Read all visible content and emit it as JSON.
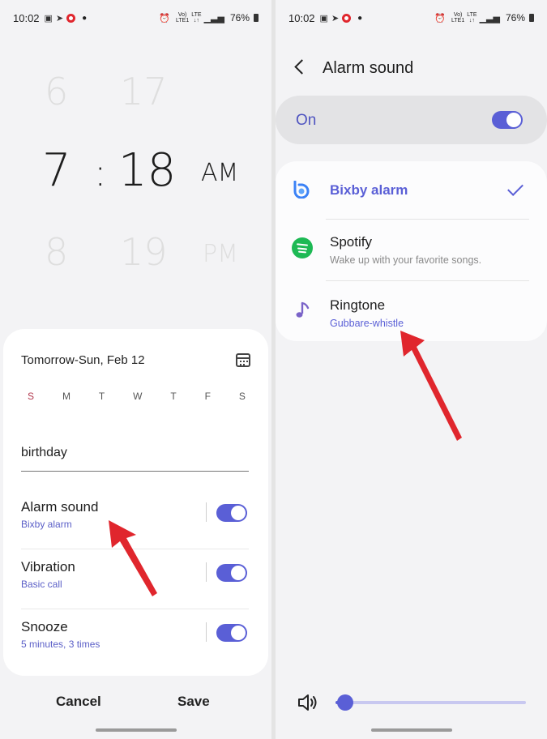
{
  "left_screen": {
    "status_bar": {
      "time": "10:02",
      "battery": "76%"
    },
    "time_picker": {
      "hours": {
        "prev": "6",
        "current": "7",
        "next": "8"
      },
      "separator": ":",
      "minutes": {
        "prev": "17",
        "current": "18",
        "next": "19"
      },
      "period": {
        "current": "AM",
        "next": "PM"
      }
    },
    "alarm": {
      "date": "Tomorrow-Sun, Feb 12",
      "days": [
        "S",
        "M",
        "T",
        "W",
        "T",
        "F",
        "S"
      ],
      "name": "birthday",
      "settings": [
        {
          "title": "Alarm sound",
          "subtitle": "Bixby alarm",
          "enabled": true
        },
        {
          "title": "Vibration",
          "subtitle": "Basic call",
          "enabled": true
        },
        {
          "title": "Snooze",
          "subtitle": "5 minutes, 3 times",
          "enabled": true
        }
      ]
    },
    "buttons": {
      "cancel": "Cancel",
      "save": "Save"
    }
  },
  "right_screen": {
    "status_bar": {
      "time": "10:02",
      "battery": "76%"
    },
    "header": {
      "title": "Alarm sound"
    },
    "master_toggle": {
      "label": "On",
      "enabled": true
    },
    "sound_options": [
      {
        "title": "Bixby alarm",
        "selected": true,
        "icon": "bixby-icon"
      },
      {
        "title": "Spotify",
        "subtitle": "Wake up with your favorite songs.",
        "icon": "spotify-icon"
      },
      {
        "title": "Ringtone",
        "subtitle": "Gubbare-whistle",
        "icon": "music-note-icon"
      }
    ],
    "volume": {
      "level": 0.05
    }
  },
  "colors": {
    "accent": "#5a5fd6",
    "sunday": "#b2384e",
    "arrow": "#e0262d",
    "spotify": "#1db954"
  }
}
